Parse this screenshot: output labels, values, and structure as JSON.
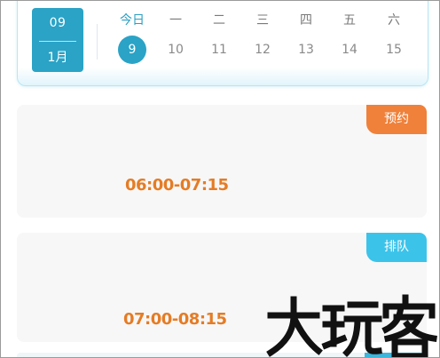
{
  "calendar": {
    "date_day": "09",
    "date_month": "1月",
    "weekdays": [
      "今日",
      "一",
      "二",
      "三",
      "四",
      "五",
      "六"
    ],
    "dates": [
      "9",
      "10",
      "11",
      "12",
      "13",
      "14",
      "15"
    ],
    "selected_index": 0
  },
  "sessions": [
    {
      "status": "预约",
      "status_color": "#f0813a",
      "time": "06:00-07:15"
    },
    {
      "status": "排队",
      "status_color": "#3cc3ea",
      "time": "07:00-08:15"
    }
  ],
  "colors": {
    "accent": "#2aa3c6",
    "time_text": "#e57c25",
    "card_bg": "#f7f7f7"
  },
  "watermark": {
    "text": "大玩客"
  }
}
